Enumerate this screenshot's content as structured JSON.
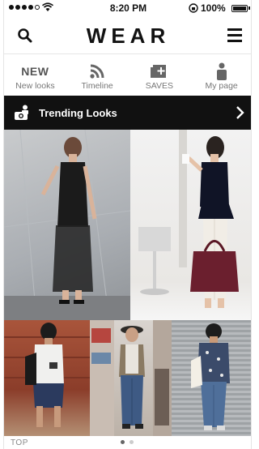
{
  "status_bar": {
    "time": "8:20 PM",
    "battery": "100%",
    "signal_bars_filled": 4,
    "signal_bars_total": 5
  },
  "header": {
    "brand": "WEAR",
    "search_icon": "search-icon",
    "menu_icon": "hamburger-menu-icon"
  },
  "nav": {
    "items": [
      {
        "icon_text": "NEW",
        "label": "New looks"
      },
      {
        "icon": "rss-icon",
        "label": "Timeline"
      },
      {
        "icon": "saves-add-icon",
        "label": "SAVES"
      },
      {
        "icon": "person-icon",
        "label": "My page"
      }
    ]
  },
  "trending": {
    "title": "Trending Looks",
    "icon": "camera-people-icon",
    "chevron": "chevron-right-icon"
  },
  "photos": [
    {
      "name": "look-photo-1"
    },
    {
      "name": "look-photo-2"
    },
    {
      "name": "look-photo-3"
    },
    {
      "name": "look-photo-4"
    },
    {
      "name": "look-photo-5"
    }
  ],
  "bottom": {
    "top_label": "TOP",
    "pages_total": 2,
    "page_active": 1
  },
  "colors": {
    "trend_bar": "#111111",
    "background": "#ffffff",
    "nav_text": "#777777"
  }
}
